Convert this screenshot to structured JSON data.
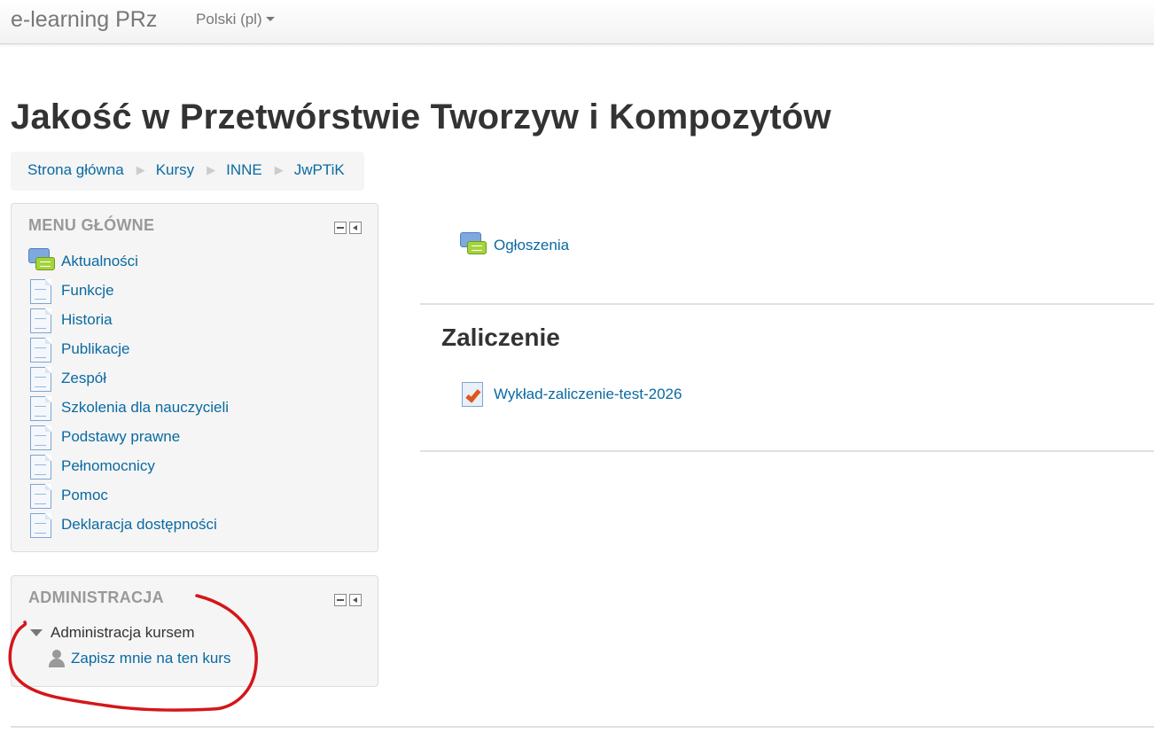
{
  "navbar": {
    "brand": "e-learning PRz",
    "language": "Polski (pl)"
  },
  "page": {
    "title": "Jakość w Przetwórstwie Tworzyw i Kompozytów"
  },
  "breadcrumb": [
    "Strona główna",
    "Kursy",
    "INNE",
    "JwPTiK"
  ],
  "main_menu": {
    "title": "MENU GŁÓWNE",
    "items": [
      {
        "label": "Aktualności",
        "icon": "forum-icon"
      },
      {
        "label": "Funkcje",
        "icon": "page-icon"
      },
      {
        "label": "Historia",
        "icon": "page-icon"
      },
      {
        "label": "Publikacje",
        "icon": "page-icon"
      },
      {
        "label": "Zespół",
        "icon": "page-icon"
      },
      {
        "label": "Szkolenia dla nauczycieli",
        "icon": "page-icon"
      },
      {
        "label": "Podstawy prawne",
        "icon": "page-icon"
      },
      {
        "label": "Pełnomocnicy",
        "icon": "page-icon"
      },
      {
        "label": "Pomoc",
        "icon": "page-icon"
      },
      {
        "label": "Deklaracja dostępności",
        "icon": "page-icon"
      }
    ]
  },
  "admin_block": {
    "title": "ADMINISTRACJA",
    "tree_head": "Administracja kursem",
    "enrol_link": "Zapisz mnie na ten kurs"
  },
  "course": {
    "general_section": {
      "activity": "Ogłoszenia",
      "icon": "forum-icon"
    },
    "section2": {
      "name": "Zaliczenie",
      "activity": "Wykład-zaliczenie-test-2026",
      "icon": "quiz-icon"
    }
  },
  "colors": {
    "link": "#0a6aa1",
    "annotation": "#d4161a"
  }
}
